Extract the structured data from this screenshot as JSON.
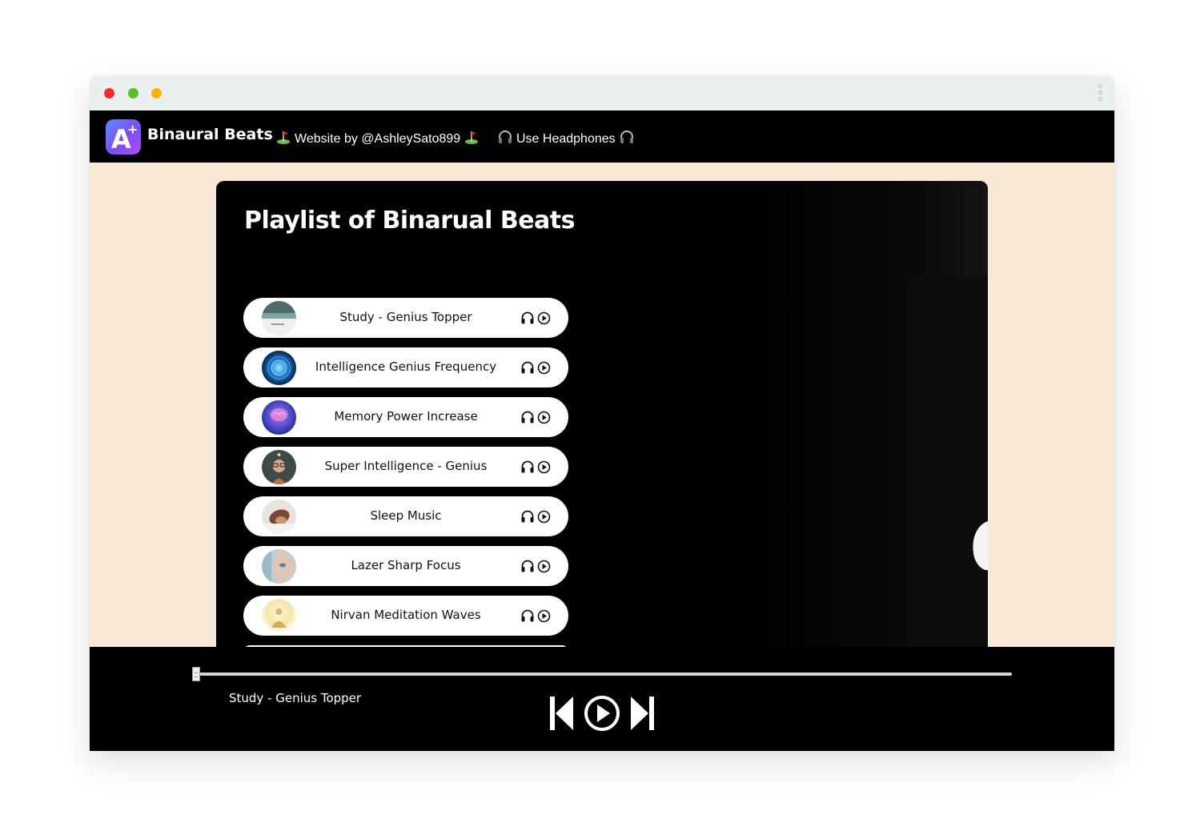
{
  "window": {
    "controls": [
      "close",
      "minimize",
      "maximize"
    ],
    "menu_icon": "kebab-menu-icon"
  },
  "navbar": {
    "brand": "Binaural Beats",
    "logo_icon": "app-logo-a-plus-icon",
    "links": [
      {
        "label": "Website by @AshleySato899",
        "icon": "golf-flag-icon"
      },
      {
        "label": "Use Headphones",
        "icon": "headphones-icon"
      }
    ]
  },
  "main": {
    "title": "Playlist of Binarual Beats",
    "tracks": [
      {
        "title": "Study - Genius Topper",
        "thumb": "study-thumb"
      },
      {
        "title": "Intelligence Genius Frequency",
        "thumb": "blue-orb-thumb"
      },
      {
        "title": "Memory Power Increase",
        "thumb": "brain-thumb"
      },
      {
        "title": "Super Intelligence - Genius",
        "thumb": "child-thumb"
      },
      {
        "title": "Sleep Music",
        "thumb": "sleeping-thumb"
      },
      {
        "title": "Lazer Sharp Focus",
        "thumb": "face-thumb"
      },
      {
        "title": "Nirvan Meditation Waves",
        "thumb": "meditation-thumb"
      }
    ]
  },
  "player": {
    "now_playing": "Study - Genius Topper",
    "progress": 0,
    "controls": [
      "previous",
      "play",
      "next"
    ]
  },
  "colors": {
    "page_background": "#f8e9d6",
    "navbar": "#000000",
    "content_panel": "#000000",
    "track_pill": "#ffffff"
  }
}
